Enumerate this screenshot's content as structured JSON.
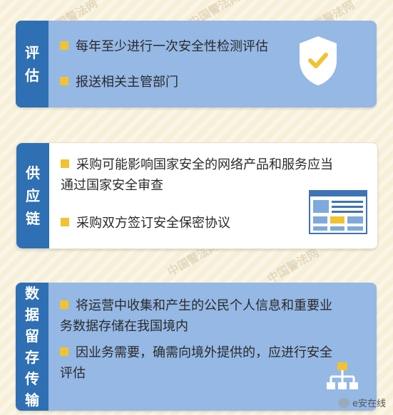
{
  "cards": [
    {
      "side_chars": [
        "评",
        "估"
      ],
      "items": [
        "每年至少进行一次安全性检测评估",
        "报送相关主管部门"
      ],
      "icon": "shield-check-icon"
    },
    {
      "side_chars": [
        "供",
        "应",
        "链"
      ],
      "items": [
        "采购可能影响国家安全的网络产品和服务应当",
        "通过国家安全审查",
        "采购双方签订安全保密协议"
      ],
      "icon": "browser-window-icon"
    },
    {
      "side_chars": [
        "数",
        "据",
        "留",
        "存",
        "传",
        "输"
      ],
      "items": [
        "将运营中收集和产生的公民个人信息和重要业",
        "务数据存储在我国境内",
        "因业务需要，确需向境外提供的，应进行安全",
        "评估"
      ],
      "icon": "hierarchy-icon"
    }
  ],
  "watermark": {
    "text": "中国警法网"
  },
  "footer": {
    "brand": "e安在线"
  },
  "colors": {
    "accent": "#2f6fb3",
    "card_blue": "#95b8e5",
    "bullet": "#f1c232",
    "background": "#f7f0d9"
  }
}
